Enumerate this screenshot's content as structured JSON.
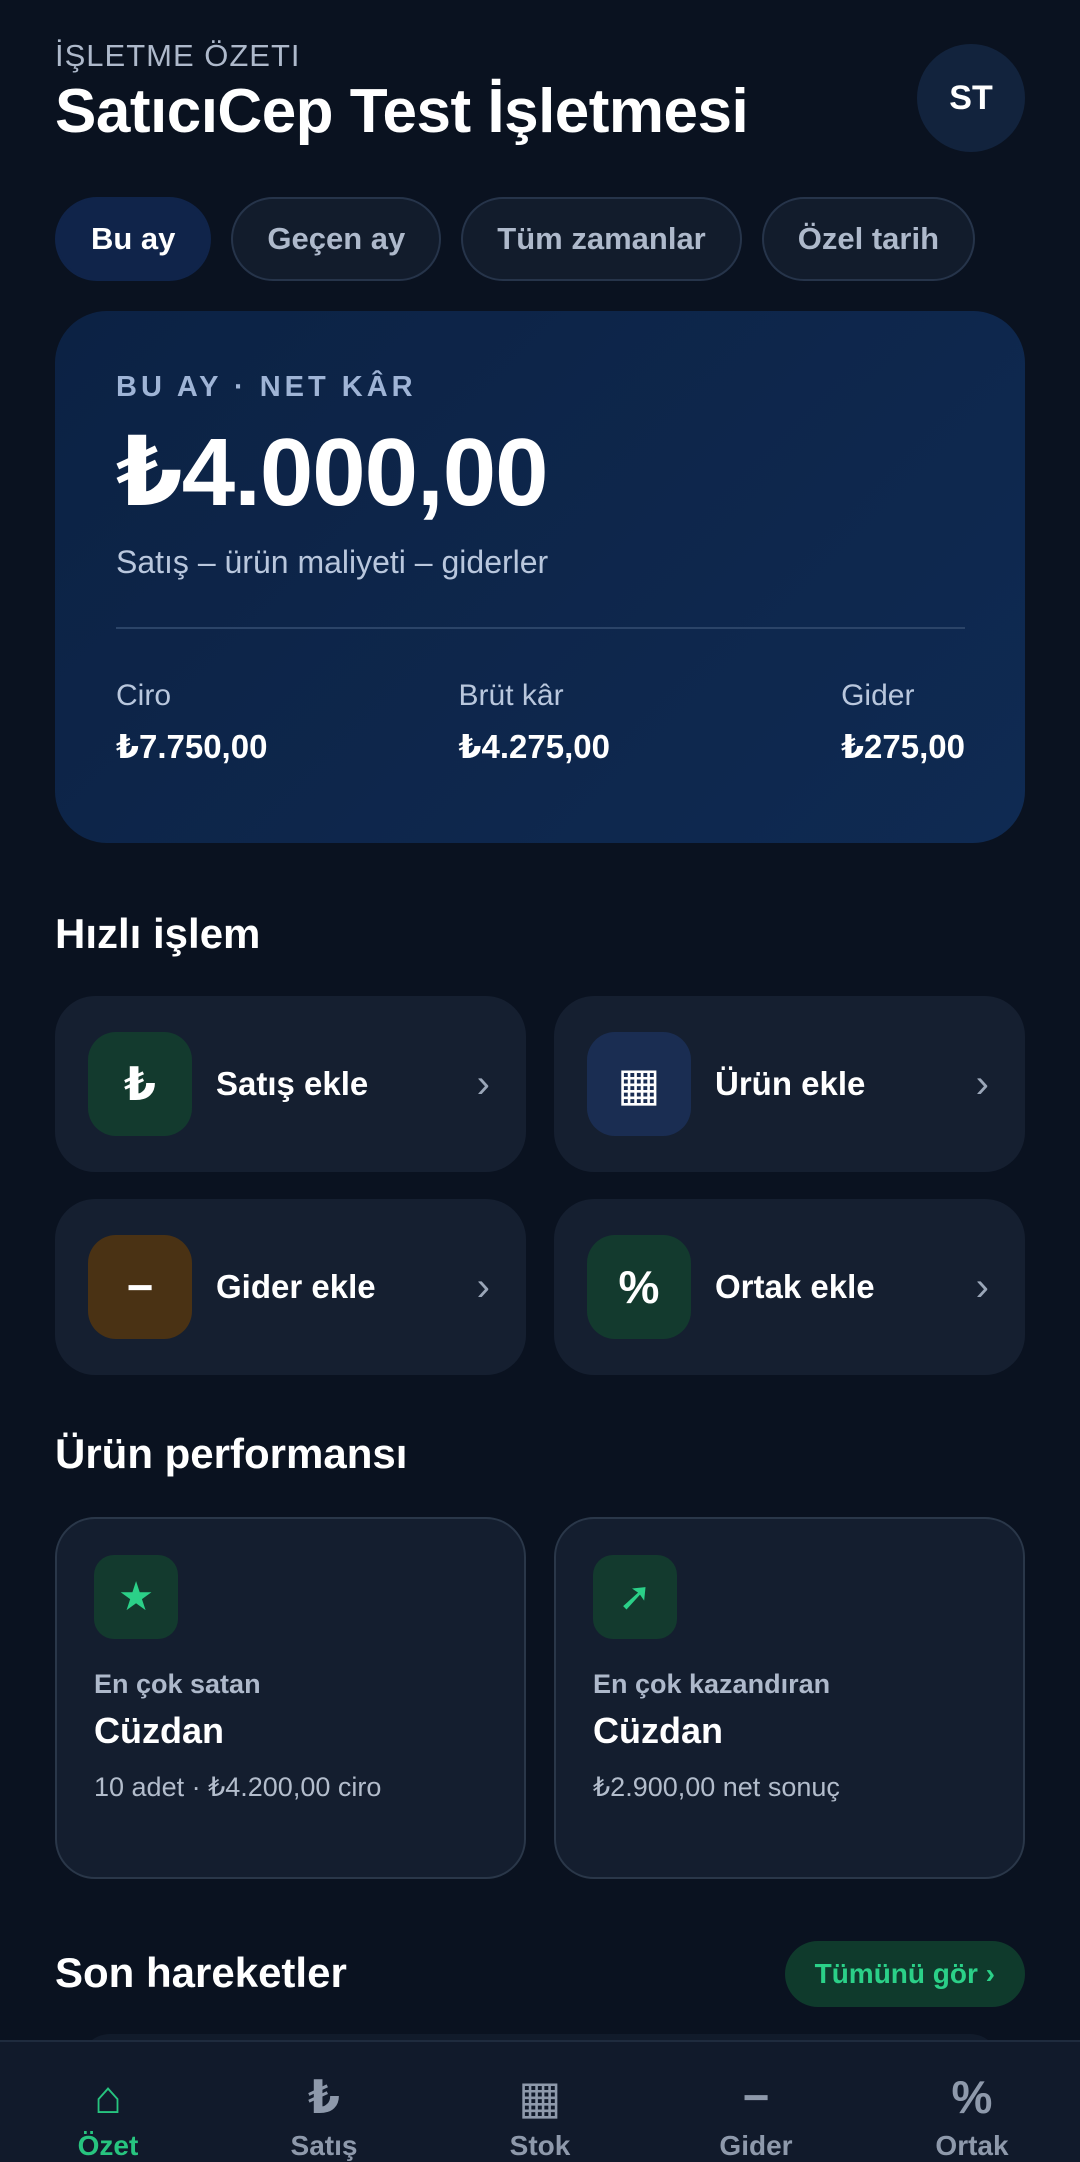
{
  "header": {
    "eyebrow": "İŞLETME ÖZETI",
    "title": "SatıcıCep Test İşletmesi",
    "avatar": "ST"
  },
  "filters": [
    {
      "label": "Bu ay",
      "active": true
    },
    {
      "label": "Geçen ay",
      "active": false
    },
    {
      "label": "Tüm zamanlar",
      "active": false
    },
    {
      "label": "Özel tarih",
      "active": false
    }
  ],
  "summary": {
    "eyebrow": "BU AY · NET KÂR",
    "net_profit": "₺4.000,00",
    "formula": "Satış – ürün maliyeti – giderler",
    "stats": [
      {
        "label": "Ciro",
        "value": "₺7.750,00"
      },
      {
        "label": "Brüt kâr",
        "value": "₺4.275,00"
      },
      {
        "label": "Gider",
        "value": "₺275,00"
      }
    ]
  },
  "quick_actions": {
    "title": "Hızlı işlem",
    "items": [
      {
        "label": "Satış ekle",
        "icon": "lira-icon",
        "glyph": "₺",
        "color": "#133a2e"
      },
      {
        "label": "Ürün ekle",
        "icon": "grid-icon",
        "glyph": "▦",
        "color": "#1a2d52"
      },
      {
        "label": "Gider ekle",
        "icon": "minus-icon",
        "glyph": "−",
        "color": "#4a3214"
      },
      {
        "label": "Ortak ekle",
        "icon": "percent-icon",
        "glyph": "%",
        "color": "#133a2e"
      }
    ],
    "chevron": "›"
  },
  "performance": {
    "title": "Ürün performansı",
    "cards": [
      {
        "icon": "star-icon",
        "glyph": "★",
        "label": "En çok satan",
        "name": "Cüzdan",
        "detail": "10 adet · ₺4.200,00 ciro"
      },
      {
        "icon": "trend-up-icon",
        "glyph": "➚",
        "label": "En çok kazandıran",
        "name": "Cüzdan",
        "detail": "₺2.900,00 net sonuç"
      }
    ]
  },
  "recent": {
    "title": "Son hareketler",
    "see_all": "Tümünü gör ›"
  },
  "nav": [
    {
      "label": "Özet",
      "icon": "home-icon",
      "glyph": "⌂",
      "active": true
    },
    {
      "label": "Satış",
      "icon": "lira-icon",
      "glyph": "₺",
      "active": false
    },
    {
      "label": "Stok",
      "icon": "grid-icon",
      "glyph": "▦",
      "active": false
    },
    {
      "label": "Gider",
      "icon": "minus-icon",
      "glyph": "−",
      "active": false
    },
    {
      "label": "Ortak",
      "icon": "percent-icon",
      "glyph": "%",
      "active": false
    }
  ],
  "colors": {
    "accent_green": "#27c47f",
    "background": "#0a1220",
    "hero": "#0f2a52"
  }
}
